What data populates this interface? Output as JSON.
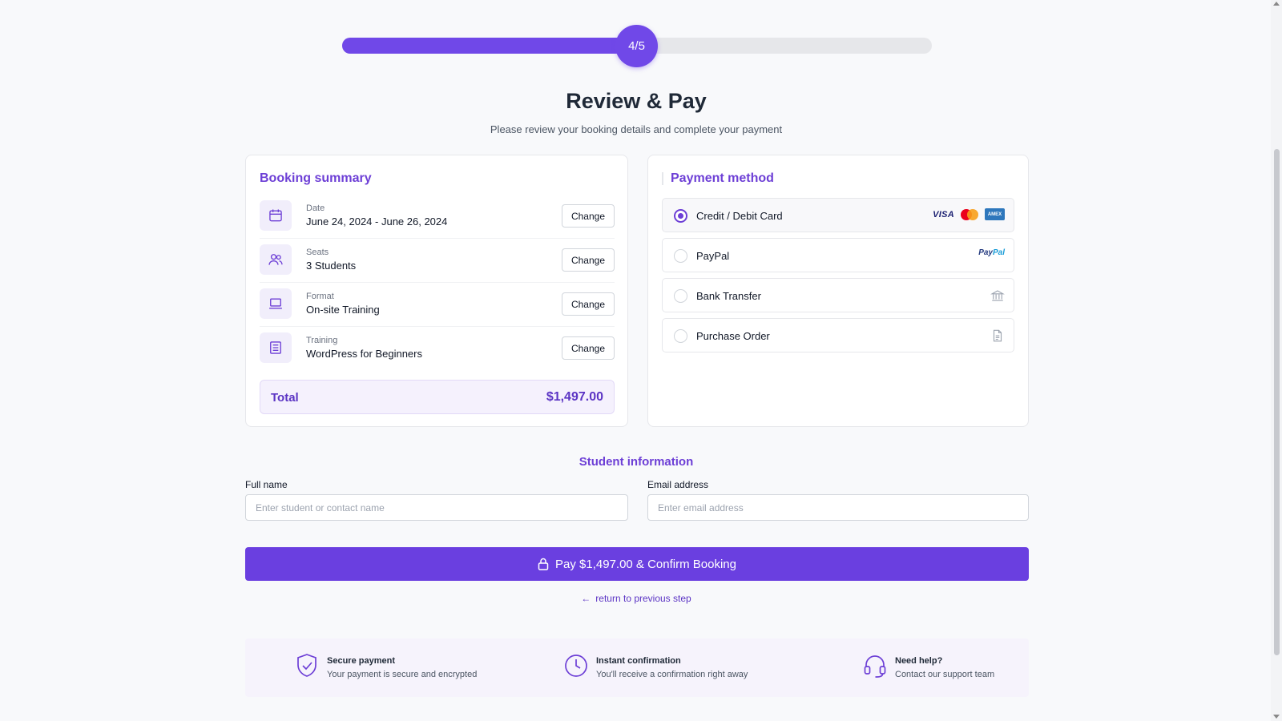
{
  "progress": {
    "label": "4/5",
    "fraction": 0.5
  },
  "header": {
    "title": "Review & Pay",
    "subtitle": "Please review your booking details and complete your payment"
  },
  "summary": {
    "title": "Booking summary",
    "rows": [
      {
        "icon": "calendar-icon",
        "label": "Date",
        "value": "June 24, 2024 - June 26, 2024",
        "button": "Change"
      },
      {
        "icon": "users-icon",
        "label": "Seats",
        "value": "3 Students",
        "button": "Change"
      },
      {
        "icon": "laptop-icon",
        "label": "Format",
        "value": "On-site Training",
        "button": "Change"
      },
      {
        "icon": "document-list-icon",
        "label": "Training",
        "value": "WordPress for Beginners",
        "button": "Change"
      }
    ],
    "total_label": "Total",
    "total_value": "$1,497.00"
  },
  "payment": {
    "title": "Payment method",
    "options": [
      {
        "label": "Credit / Debit Card",
        "selected": true,
        "icons": [
          "visa-logo",
          "mastercard-logo",
          "amex-logo"
        ]
      },
      {
        "label": "PayPal",
        "selected": false,
        "icons": [
          "paypal-logo"
        ]
      },
      {
        "label": "Bank Transfer",
        "selected": false,
        "icons": [
          "bank-icon"
        ]
      },
      {
        "label": "Purchase Order",
        "selected": false,
        "icons": [
          "document-icon"
        ]
      }
    ],
    "brand_text": {
      "visa": "VISA",
      "amex": "AMEX",
      "paypal_p1": "Pay",
      "paypal_p2": "Pal"
    }
  },
  "student": {
    "title": "Student information",
    "name_label": "Full name",
    "name_placeholder": "Enter student or contact name",
    "name_value": "",
    "email_label": "Email address",
    "email_placeholder": "Enter email address",
    "email_value": ""
  },
  "actions": {
    "pay_label": "Pay $1,497.00 & Confirm Booking",
    "back_label": "return to previous step"
  },
  "features": [
    {
      "icon": "shield-check-icon",
      "title": "Secure payment",
      "desc": "Your payment is secure and encrypted"
    },
    {
      "icon": "clock-icon",
      "title": "Instant confirmation",
      "desc": "You'll receive a confirmation right away"
    },
    {
      "icon": "headset-icon",
      "title": "Need help?",
      "desc": "Contact our support team"
    }
  ],
  "colors": {
    "accent": "#6a3fe0",
    "accent_text": "#6d3fd6",
    "track": "#e6e7ea"
  }
}
